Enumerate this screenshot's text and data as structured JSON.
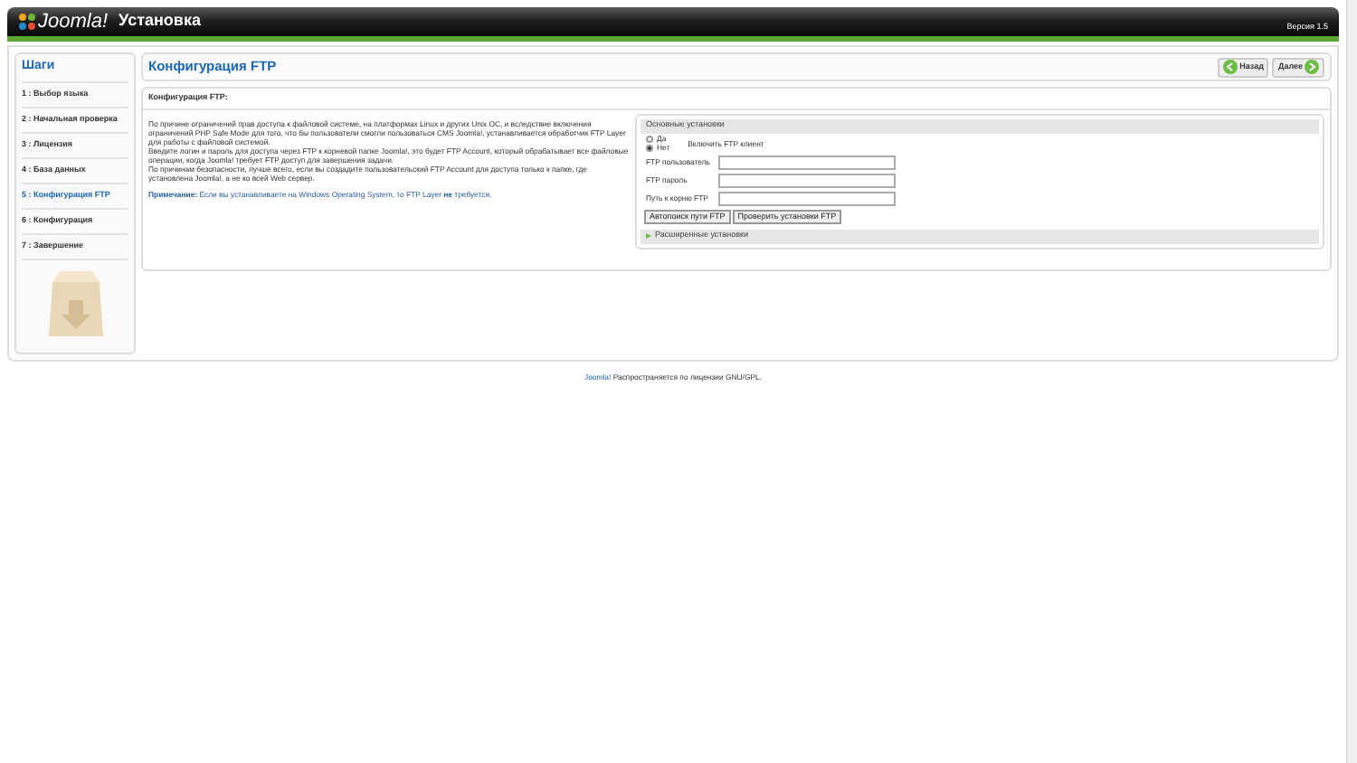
{
  "header": {
    "logo": "Joomla!",
    "title": "Установка",
    "version": "Версия 1.5"
  },
  "sidebar": {
    "title": "Шаги",
    "steps": [
      {
        "label": "1 : Выбор языка",
        "selected": false
      },
      {
        "label": "2 : Начальная проверка",
        "selected": false
      },
      {
        "label": "3 : Лицензия",
        "selected": false
      },
      {
        "label": "4 : База данных",
        "selected": false
      },
      {
        "label": "5 : Конфигурация FTP",
        "selected": true
      },
      {
        "label": "6 : Конфигурация",
        "selected": false
      },
      {
        "label": "7 : Завершение",
        "selected": false
      }
    ]
  },
  "page_title": "Конфигурация FTP",
  "nav_buttons": [
    {
      "label": "Назад",
      "kind": "back"
    },
    {
      "label": "Далее",
      "kind": "next"
    }
  ],
  "section_title": "Конфигурация FTP:",
  "intro": [
    "По причине ограничений прав доступа к файловой системе, на платформах Linux и других Unix ОС, и вследствие включения ограничений PHP Safe Mode для того, что бы пользователи смогли пользоваться CMS Joomla!, устанавливается обработчик FTP Layer для работы с файловой системой.",
    "Введите логин и пароль для доступа через FTP к корневой папке Joomla!, это будет FTP Account, который обрабатывает все файловые операции, когда Joomla! требует FTP доступ для завершения задачи.",
    "По причинам безопасности, лучше всего, если вы создадите пользовательский FTP Account для доступа только к папке, где установлена Joomla!, а не ко всей Web сервер."
  ],
  "note": "**Примечание:** Если вы устанавливаете на Windows Operating System, то FTP Layer **не** требуется.",
  "basic_settings": {
    "title": "Основные установки",
    "radios": [
      {
        "label": "Да",
        "selected": false
      },
      {
        "label": "Нет",
        "selected": true
      }
    ],
    "enable_label": "Включить FTP клиент",
    "fields": [
      {
        "label": "FTP пользователь"
      },
      {
        "label": "FTP пароль"
      },
      {
        "label": "Путь к корню FTP"
      }
    ],
    "buttons": [
      "Автопоиск пути FTP",
      "Проверить установки FTP"
    ]
  },
  "advanced_settings": {
    "title": "Расширенные установки",
    "expanded": false
  },
  "footer": {
    "link": "Joomla!",
    "text": "Распространяется по лицензии GNU/GPL."
  }
}
